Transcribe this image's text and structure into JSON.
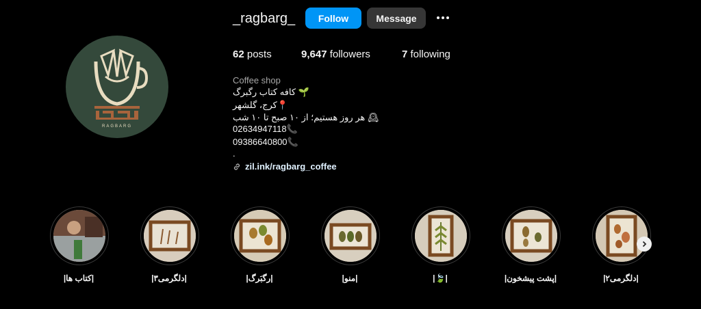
{
  "profile": {
    "username": "_ragbarg_",
    "follow_label": "Follow",
    "message_label": "Message",
    "more_icon": "more-dots-icon",
    "logo_text": "RAGBARG"
  },
  "stats": {
    "posts_count": "62",
    "posts_label": "posts",
    "followers_count": "9,647",
    "followers_label": "followers",
    "following_count": "7",
    "following_label": "following"
  },
  "bio": {
    "category": "Coffee shop",
    "line1": "🌱 کافه کتاب رگبرگ",
    "line2": "📍کرج، گلشهر",
    "line3": "🕰 هر روز هستیم؛ از ۱۰ صبح تا ۱۰ شب",
    "line4": "02634947118📞",
    "line5": "09386640800📞",
    "line6": ".",
    "link": "zil.ink/ragbarg_coffee",
    "link_icon": "link-icon"
  },
  "highlights": [
    {
      "label": "|کتاب ها|"
    },
    {
      "label": "|دلگرمی۳|"
    },
    {
      "label": "|رگبَرگ|"
    },
    {
      "label": "|منو|"
    },
    {
      "label": "|🍃|"
    },
    {
      "label": "|پشت پیشخون|"
    },
    {
      "label": "|دلگرمی۲|"
    }
  ],
  "colors": {
    "background": "#000000",
    "follow_button": "#0095f6",
    "message_button": "#363636",
    "avatar_bg": "#34493b",
    "logo_color": "#e8dcc0",
    "logo_accent": "#a8643c"
  }
}
